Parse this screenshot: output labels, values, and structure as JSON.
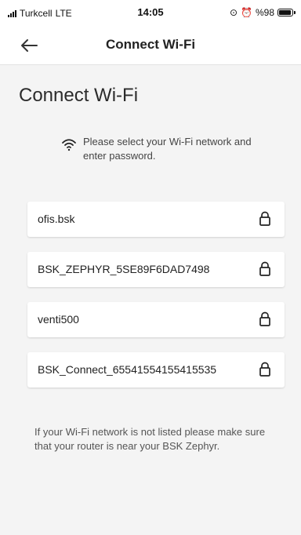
{
  "status_bar": {
    "carrier": "Turkcell",
    "network": "LTE",
    "time": "14:05",
    "battery": "%98"
  },
  "header": {
    "title": "Connect Wi-Fi"
  },
  "page": {
    "title": "Connect Wi-Fi",
    "instruction": "Please select your Wi-Fi network and enter password.",
    "footer_note": "If your Wi-Fi network is not listed please make sure that your router is near your BSK Zephyr."
  },
  "networks": [
    {
      "name": "ofis.bsk",
      "icon": "lock-icon"
    },
    {
      "name": "BSK_ZEPHYR_5SE89F6DAD7498",
      "icon": "lock-icon"
    },
    {
      "name": "venti500",
      "icon": "lock-icon"
    },
    {
      "name": "BSK_Connect_65541554155415535",
      "icon": "lock-icon"
    }
  ],
  "colors": {
    "background": "#f4f4f4",
    "surface": "#ffffff",
    "text": "#222222",
    "muted": "#555555"
  }
}
